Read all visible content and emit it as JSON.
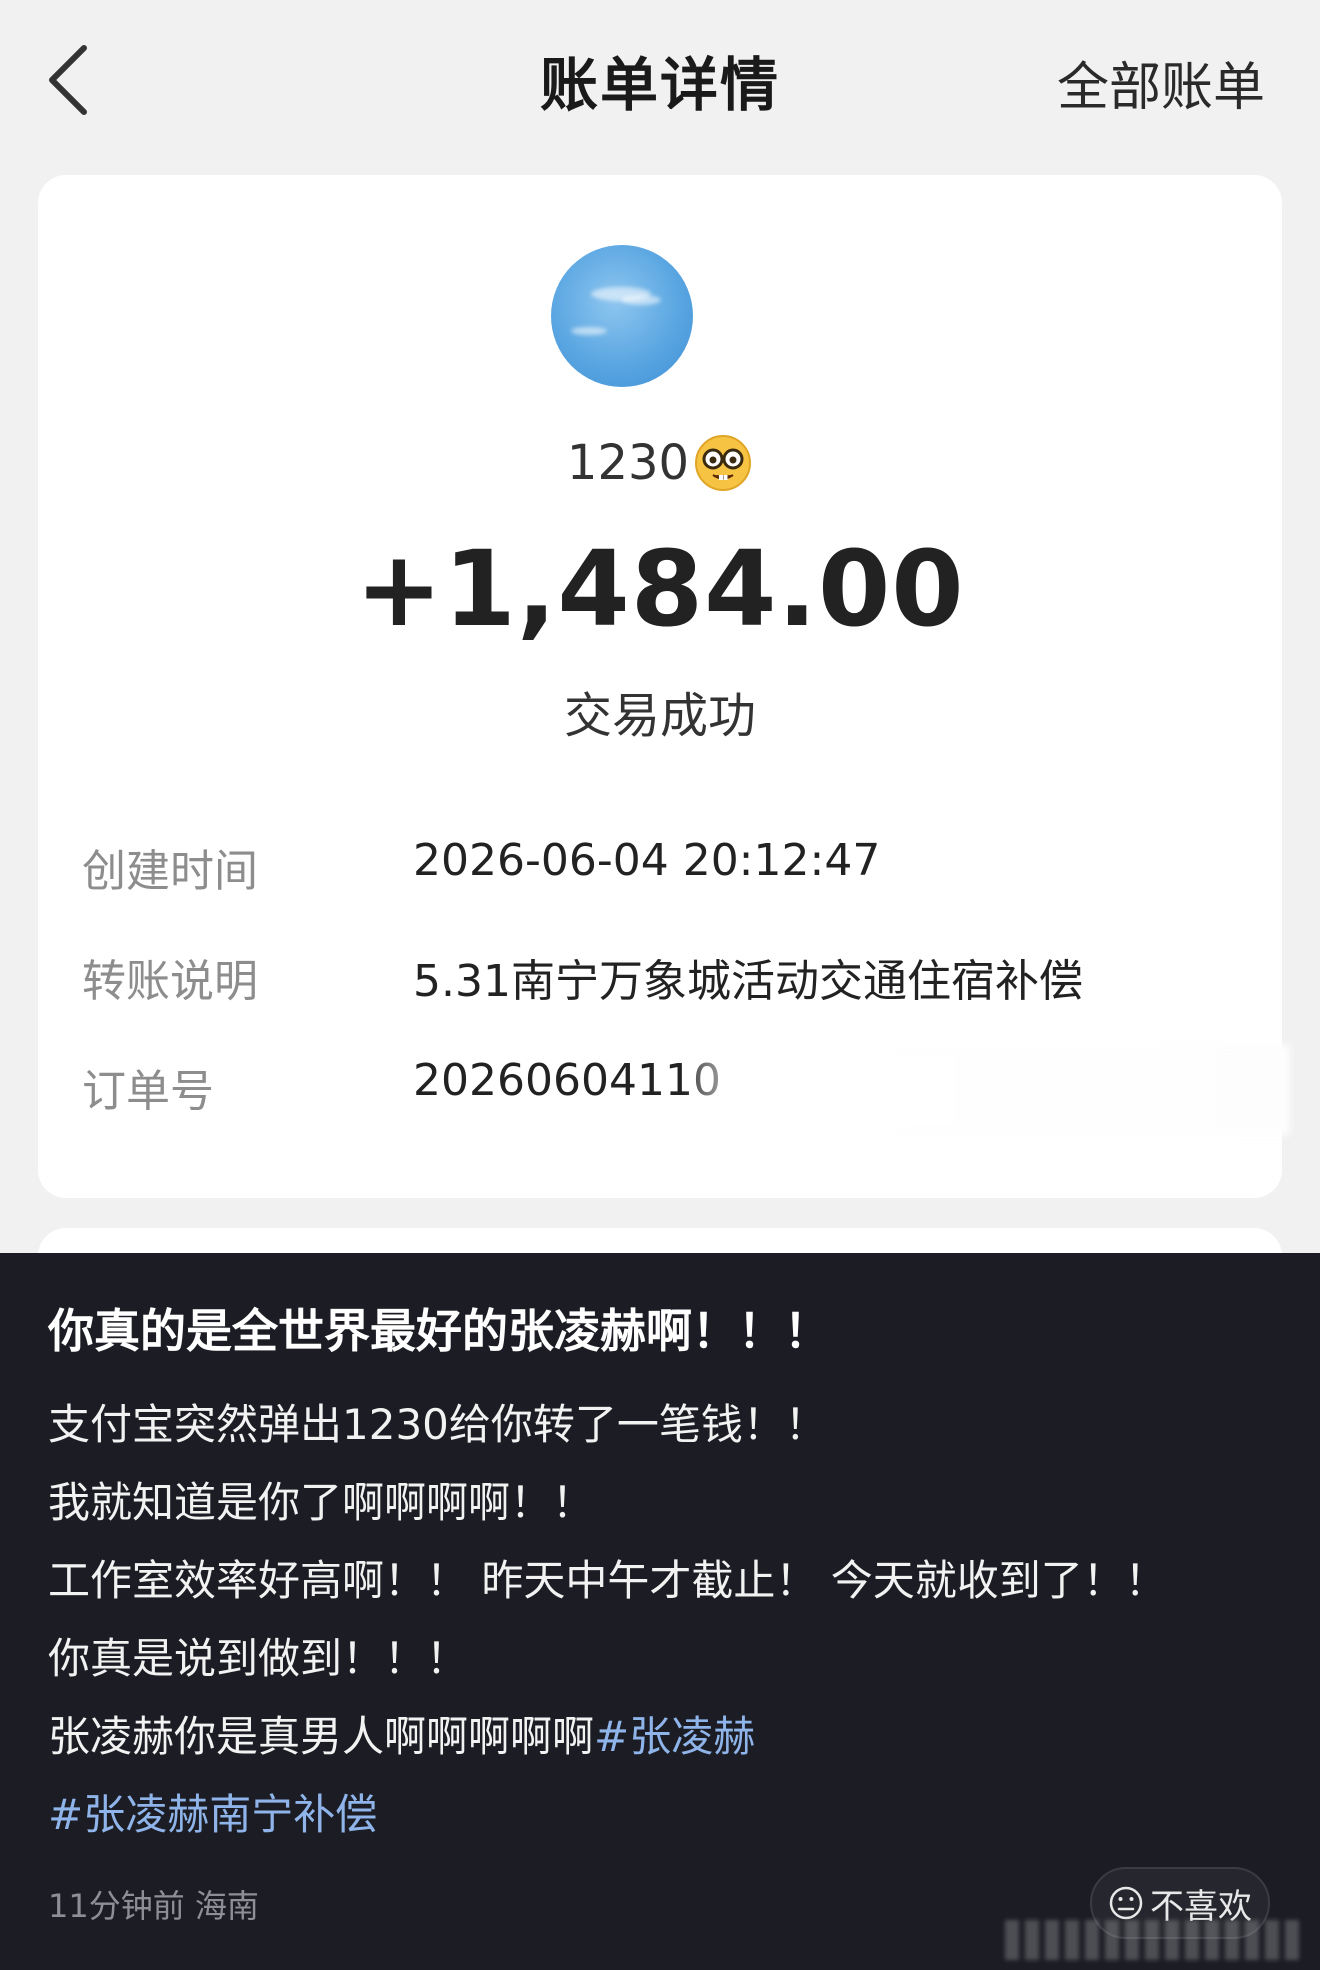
{
  "nav": {
    "title": "账单详情",
    "all_bills_label": "全部账单",
    "back_icon": "chevron-left-icon"
  },
  "bill": {
    "payer_name": "1230",
    "payer_emoji": "nerd-face-icon",
    "amount": "+1,484.00",
    "status": "交易成功",
    "details": [
      {
        "label": "创建时间",
        "value": "2026-06-04 20:12:47"
      },
      {
        "label": "转账说明",
        "value": "5.31南宁万象城活动交通住宿补偿"
      },
      {
        "label": "订单号",
        "value": "20260604110"
      }
    ]
  },
  "post": {
    "title": "你真的是全世界最好的张凌赫啊！！！",
    "lines": [
      "支付宝突然弹出1230给你转了一笔钱！！",
      "我就知道是你了啊啊啊啊！！",
      "工作室效率好高啊！！ 昨天中午才截止！ 今天就收到了！！",
      "你真是说到做到！！！",
      "张凌赫你是真男人啊啊啊啊啊"
    ],
    "hashtags": [
      "#张凌赫",
      "#张凌赫南宁补偿"
    ],
    "meta": "11分钟前 海南",
    "dislike_label": "不喜欢",
    "colors": {
      "panel_bg": "#1c1d24",
      "hashtag": "#8fb4ea"
    }
  }
}
